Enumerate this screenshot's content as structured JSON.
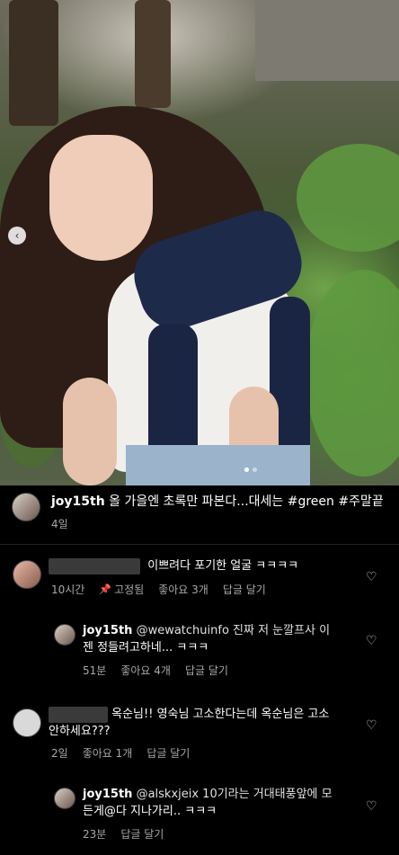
{
  "post": {
    "image_alt": "photo-carousel",
    "carousel": {
      "arrow": "‹",
      "dots": 2,
      "active_dot": 1
    }
  },
  "caption": {
    "username": "joy15th",
    "text": "올 가을엔 초록만 파본다...대세는 #green #주말끝",
    "time": "4일"
  },
  "comments": [
    {
      "text": "이쁘려다 포기한 얼굴 ㅋㅋㅋㅋ",
      "time": "10시간",
      "pinned_label": "고정됨",
      "likes": "좋아요 3개",
      "reply": "답글 달기"
    },
    {
      "username": "joy15th",
      "text_line1": "@wewatchuinfo 진짜 저 눈깔프사 이",
      "text_line2": "젠 정들려고하네... ㅋㅋㅋ",
      "time": "51분",
      "likes": "좋아요 4개",
      "reply": "답글 달기"
    },
    {
      "text_line1": "옥순님!! 영숙님 고소한다는데 옥순님은 고소",
      "text_line2": "안하세요???",
      "time": "2일",
      "likes": "좋아요 1개",
      "reply": "답글 달기"
    },
    {
      "username": "joy15th",
      "text_line1": "@alskxjeix 10기라는 거대태풍앞에 모",
      "text_line2": "든게@다 지나가리.. ㅋㅋㅋ",
      "time": "23분",
      "reply": "답글 달기"
    }
  ],
  "icons": {
    "heart": "♡",
    "pin": "📌"
  }
}
